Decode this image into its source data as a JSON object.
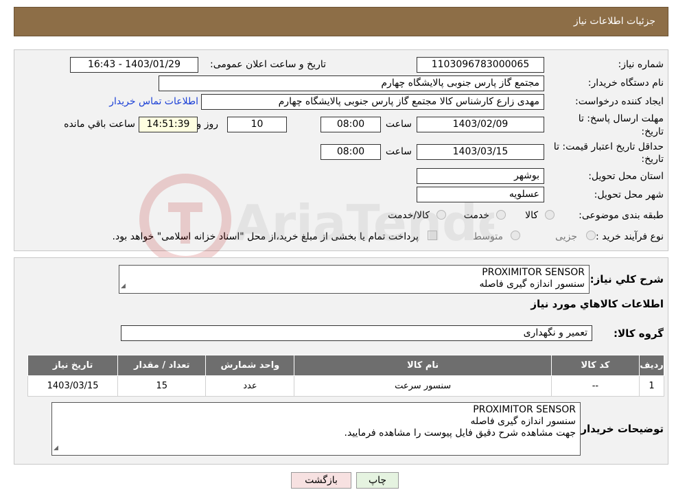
{
  "header": {
    "title": "جزئیات اطلاعات نیاز"
  },
  "details": {
    "need_number_label": "شماره نیاز:",
    "need_number": "1103096783000065",
    "announce_label": "تاریخ و ساعت اعلان عمومی:",
    "announce_value": "1403/01/29 - 16:43",
    "buyer_org_label": "نام دستگاه خریدار:",
    "buyer_org": "مجتمع گاز پارس جنوبی  پالایشگاه چهارم",
    "creator_label": "ایجاد کننده درخواست:",
    "creator": "مهدی زارع کارشناس کالا مجتمع گاز پارس جنوبی  پالایشگاه چهارم",
    "contact_link": "اطلاعات تماس خریدار",
    "deadline_label_1": "مهلت ارسال پاسخ: تا",
    "deadline_label_2": "تاریخ:",
    "deadline_date": "1403/02/09",
    "time_label": "ساعت",
    "deadline_time": "08:00",
    "days_value": "10",
    "days_label": "روز و",
    "remaining_time": "14:51:39",
    "remaining_label": "ساعت باقي مانده",
    "validity_label_1": "حداقل تاریخ اعتبار قیمت: تا",
    "validity_label_2": "تاریخ:",
    "validity_date": "1403/03/15",
    "validity_time": "08:00",
    "province_label": "استان محل تحویل:",
    "province": "بوشهر",
    "city_label": "شهر محل تحویل:",
    "city": "عسلویه",
    "category_label": "طبقه بندی موضوعی:",
    "category_options": [
      "کالا",
      "خدمت",
      "کالا/خدمت"
    ],
    "process_label": "نوع فرآیند خرید :",
    "process_options": [
      "جزیی",
      "متوسط"
    ],
    "payment_note": "پرداخت تمام یا بخشی از مبلغ خرید،از محل \"اسناد خزانه اسلامی\" خواهد بود."
  },
  "summary": {
    "general_desc_label": "شرح کلي نياز:",
    "general_desc_line1": "PROXIMITOR SENSOR",
    "general_desc_line2": "سنسور اندازه گیری فاصله",
    "goods_info_title": "اطلاعات کالاهاي مورد نياز",
    "goods_group_label": "گروه کالا:",
    "goods_group": "تعمیر و نگهداری"
  },
  "table": {
    "headers": [
      "رديف",
      "کد کالا",
      "نام کالا",
      "واحد شمارش",
      "تعداد / مقدار",
      "تاریخ نیاز"
    ],
    "rows": [
      [
        "1",
        "--",
        "سنسور سرعت",
        "عدد",
        "15",
        "1403/03/15"
      ]
    ]
  },
  "buyer_notes": {
    "label": "توضیحات خریدار:",
    "line1": "PROXIMITOR SENSOR",
    "line2": "سنسور اندازه گیری فاصله",
    "line3": "جهت مشاهده شرح دقیق فایل پیوست را مشاهده فرمایید."
  },
  "buttons": {
    "back": "بازگشت",
    "print": "چاپ"
  },
  "colors": {
    "header_bg": "#8d6e47",
    "table_header_bg": "#6e6e6e",
    "link": "#1a3fd6"
  },
  "watermark": {
    "text": "AriaTender.neT"
  }
}
